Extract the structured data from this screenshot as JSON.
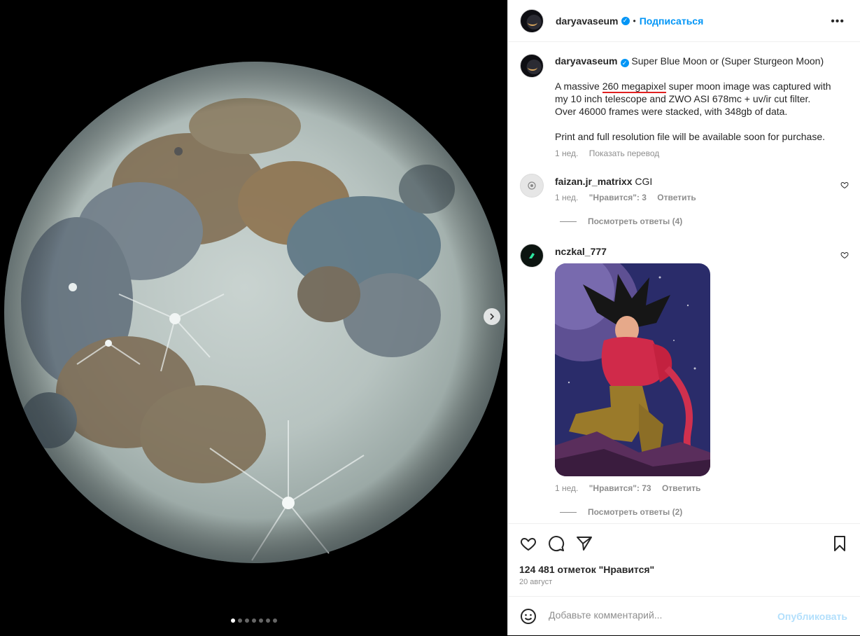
{
  "post": {
    "username": "daryavaseum",
    "follow_label": "Подписаться",
    "separator": "•",
    "caption": {
      "title": "Super Blue Moon or (Super Sturgeon Moon)",
      "line1_pre": "A massive ",
      "line1_highlight": "260 megapixel",
      "line1_post": " super moon image was captured with",
      "line2": "my 10 inch telescope and ZWO ASI 678mc + uv/ir cut filter.",
      "line3": "Over 46000 frames were stacked, with 348gb of data.",
      "line4": "Print and full resolution file will be available soon for purchase.",
      "time": "1 нед.",
      "translate": "Показать перевод"
    },
    "comments": [
      {
        "username": "faizan.jr_matrixx",
        "text": "CGI",
        "time": "1 нед.",
        "likes": "\"Нравится\": 3",
        "reply": "Ответить",
        "view_replies": "Посмотреть ответы (4)"
      },
      {
        "username": "nczkal_777",
        "text": "",
        "time": "1 нед.",
        "likes": "\"Нравится\": 73",
        "reply": "Ответить",
        "view_replies": "Посмотреть ответы (2)"
      }
    ],
    "likes_count": "124 481 отметок \"Нравится\"",
    "date": "20 август",
    "comment_placeholder": "Добавьте комментарий...",
    "publish_label": "Опубликовать",
    "carousel": {
      "total": 7,
      "active": 1
    }
  },
  "icons": {
    "more": "more-options-icon",
    "like": "heart-icon",
    "comment": "comment-icon",
    "share": "share-icon",
    "save": "bookmark-icon",
    "emoji": "emoji-icon",
    "next": "chevron-right-icon"
  },
  "colors": {
    "accent": "#0095f6",
    "highlight_underline": "#e02020",
    "publish_disabled": "#b2dffc"
  }
}
